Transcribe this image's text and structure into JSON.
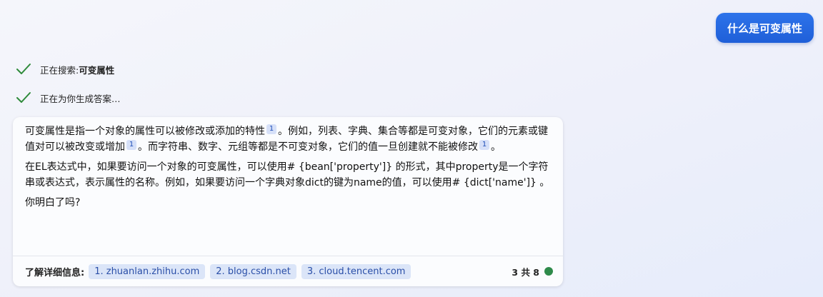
{
  "user_message": "什么是可变属性",
  "status": [
    {
      "label": "正在搜索: ",
      "detail": "可变属性"
    },
    {
      "label": "正在为你生成答案…",
      "detail": ""
    }
  ],
  "answer": {
    "p1": {
      "s1": "可变属性是指一个对象的属性可以被修改或添加的特性",
      "c1": "1",
      "s2": "。例如，列表、字典、集合等都是可变对象，它们的元素或键值对可以被改变或增加",
      "c2": "1",
      "s3": "。而字符串、数字、元组等都是不可变对象，它们的值一旦创建就不能被修改",
      "c3": "1",
      "s4": "。"
    },
    "p2": "在EL表达式中，如果要访问一个对象的可变属性，可以使用# {bean['property']} 的形式，其中property是一个字符串或表达式，表示属性的名称。例如，如果要访问一个字典对象dict的键为name的值，可以使用# {dict['name']} 。",
    "p3": "你明白了吗?"
  },
  "footer": {
    "label": "了解详细信息:",
    "links": [
      "1. zhuanlan.zhihu.com",
      "2. blog.csdn.net",
      "3. cloud.tencent.com"
    ],
    "count": "3 共 8",
    "dot_color": "#2e8a4a"
  },
  "colors": {
    "accent": "#1f5fd8",
    "check": "#2e8a3a"
  }
}
